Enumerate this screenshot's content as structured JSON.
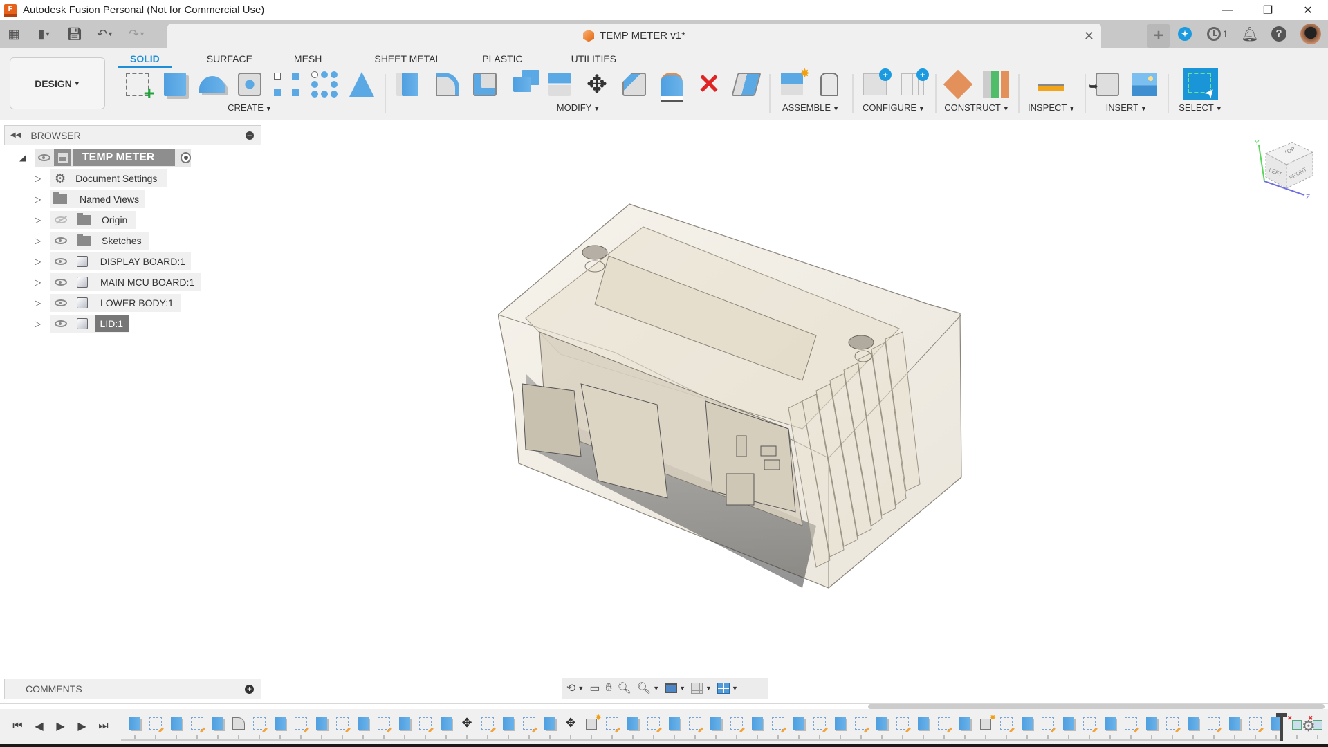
{
  "window": {
    "title": "Autodesk Fusion Personal (Not for Commercial Use)",
    "controls": [
      "minimize",
      "restore",
      "close"
    ]
  },
  "quick_access": {
    "icons": [
      "grid-apps-icon",
      "file-icon",
      "save-icon",
      "undo-icon",
      "redo-icon"
    ]
  },
  "document_tab": {
    "title": "TEMP METER v1*",
    "close_glyph": "✕"
  },
  "top_right": {
    "new_tab": "+",
    "job_count": "1"
  },
  "workspace": {
    "label": "DESIGN",
    "caret": "▼"
  },
  "tabs": [
    {
      "label": "SOLID",
      "active": true
    },
    {
      "label": "SURFACE",
      "active": false
    },
    {
      "label": "MESH",
      "active": false
    },
    {
      "label": "SHEET METAL",
      "active": false
    },
    {
      "label": "PLASTIC",
      "active": false
    },
    {
      "label": "UTILITIES",
      "active": false
    }
  ],
  "tool_groups": [
    {
      "label": "CREATE",
      "tools": [
        "create-sketch",
        "extrude",
        "revolve",
        "hole",
        "rectangular-pattern",
        "circular-pattern",
        "mirror"
      ]
    },
    {
      "label": "MODIFY",
      "tools": [
        "press-pull",
        "fillet",
        "shell",
        "combine",
        "split-body",
        "move-copy",
        "chamfer",
        "offset-face",
        "delete",
        "draft"
      ]
    },
    {
      "label": "ASSEMBLE",
      "tools": [
        "new-component",
        "joint"
      ]
    },
    {
      "label": "CONFIGURE",
      "tools": [
        "configure-model",
        "configuration-table"
      ]
    },
    {
      "label": "CONSTRUCT",
      "tools": [
        "offset-plane",
        "midplane"
      ]
    },
    {
      "label": "INSPECT",
      "tools": [
        "measure"
      ]
    },
    {
      "label": "INSERT",
      "tools": [
        "insert-derive",
        "insert-canvas"
      ]
    },
    {
      "label": "SELECT",
      "tools": [
        "window-select"
      ]
    }
  ],
  "browser": {
    "title": "BROWSER",
    "root": {
      "label": "TEMP METER v1"
    },
    "items": [
      {
        "label": "Document Settings",
        "icon": "gear",
        "eye": "none"
      },
      {
        "label": "Named Views",
        "icon": "folder",
        "eye": "none"
      },
      {
        "label": "Origin",
        "icon": "folder",
        "eye": "hidden"
      },
      {
        "label": "Sketches",
        "icon": "folder",
        "eye": "visible"
      },
      {
        "label": "DISPLAY BOARD:1",
        "icon": "component",
        "eye": "visible"
      },
      {
        "label": "MAIN MCU BOARD:1",
        "icon": "component",
        "eye": "visible"
      },
      {
        "label": "LOWER BODY:1",
        "icon": "component",
        "eye": "visible"
      },
      {
        "label": "LID:1",
        "icon": "component",
        "eye": "visible",
        "selected": true
      }
    ]
  },
  "viewcube": {
    "faces": [
      "TOP",
      "LEFT",
      "FRONT"
    ],
    "axes": [
      "Y",
      "Z"
    ]
  },
  "comments": {
    "title": "COMMENTS"
  },
  "nav_bar": {
    "tools": [
      "orbit",
      "look-at",
      "pan",
      "zoom",
      "fit",
      "display-settings",
      "grid-settings",
      "viewports"
    ]
  },
  "timeline": {
    "features": [
      "ext",
      "sk",
      "ext",
      "sk",
      "ext",
      "fil",
      "sk",
      "ext",
      "sk",
      "ext",
      "sk",
      "ext",
      "sk",
      "ext",
      "sk",
      "ext",
      "mv",
      "sk",
      "ext",
      "sk",
      "ext",
      "mv",
      "new",
      "sk",
      "ext",
      "sk",
      "ext",
      "sk",
      "ext",
      "sk",
      "ext",
      "sk",
      "ext",
      "sk",
      "ext",
      "sk",
      "ext",
      "sk",
      "ext",
      "sk",
      "ext",
      "new",
      "sk",
      "ext",
      "sk",
      "ext",
      "sk",
      "ext",
      "sk",
      "ext",
      "sk",
      "ext",
      "sk",
      "ext",
      "sk",
      "ext",
      "x",
      "x",
      "sk",
      "ext"
    ]
  }
}
